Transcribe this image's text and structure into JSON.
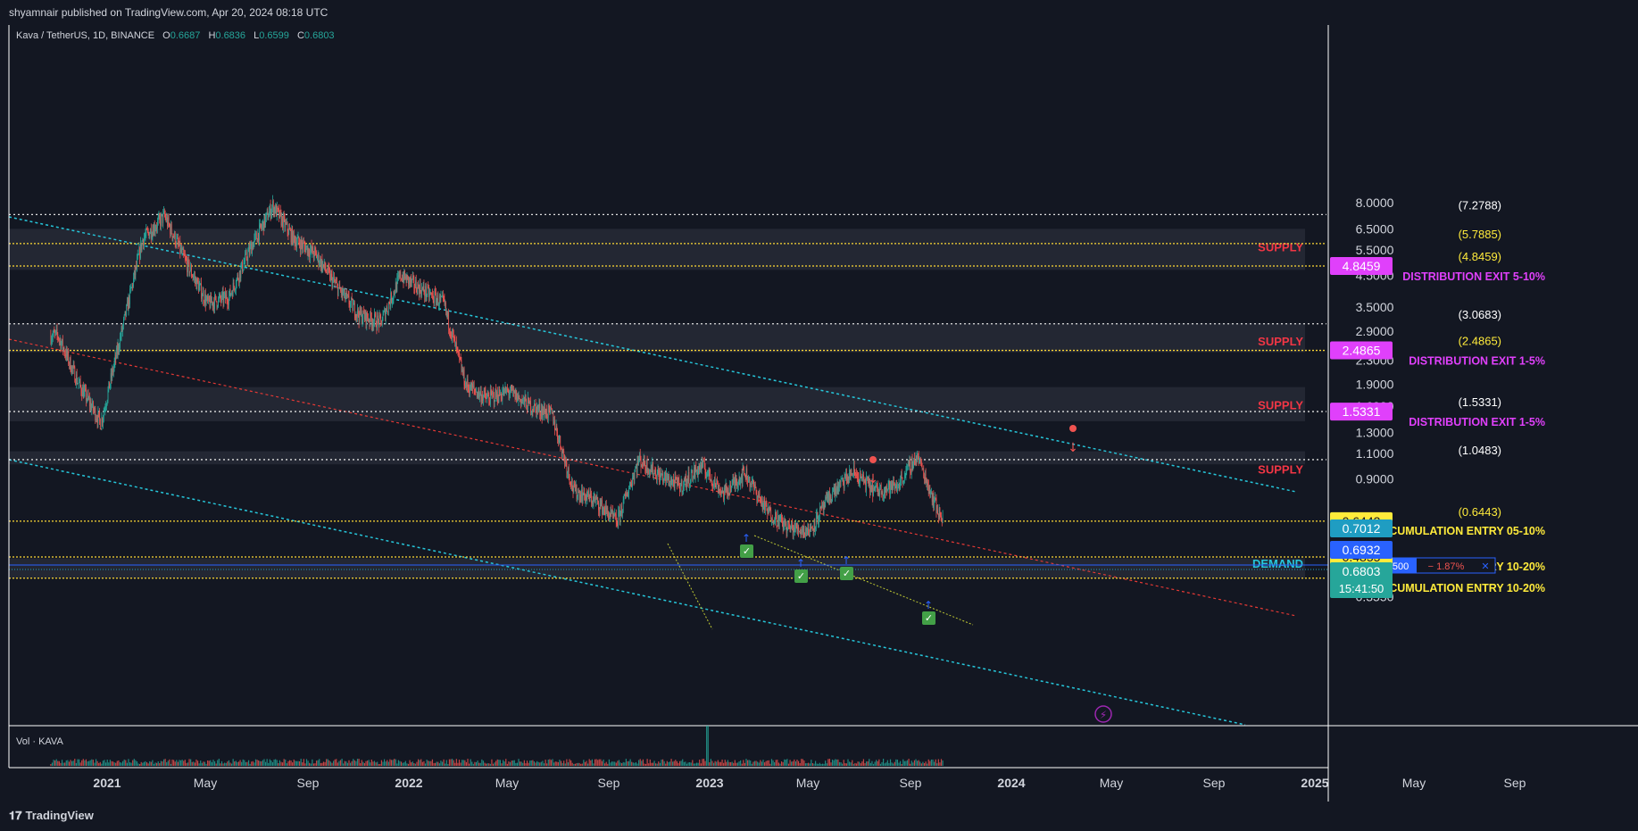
{
  "header": {
    "published": "shyamnair published on TradingView.com, Apr 20, 2024 08:18 UTC"
  },
  "symbol": {
    "title": "Kava / TetherUS, 1D, BINANCE",
    "o_label": "O",
    "o": "0.6687",
    "h_label": "H",
    "h": "0.6836",
    "l_label": "L",
    "l": "0.6599",
    "c_label": "C",
    "c": "0.6803"
  },
  "volume_label": "Vol · KAVA",
  "footer": {
    "brand": "TradingView"
  },
  "colors": {
    "background": "#131722",
    "up": "#26a69a",
    "down": "#ef5350",
    "channel": "#26c6da",
    "midline": "#e53935",
    "supply_text": "#f23645",
    "distribution": "#e040fb",
    "accumulation": "#ffeb3b",
    "demand": "#26c6da"
  },
  "chart_data": {
    "type": "line",
    "title": "",
    "y_scale": "log",
    "ylim": [
      0.33,
      8.6
    ],
    "x_ticks": [
      "2021",
      "May",
      "Sep",
      "2022",
      "May",
      "Sep",
      "2023",
      "May",
      "Sep",
      "2024",
      "May",
      "Sep",
      "2025",
      "May",
      "Sep"
    ],
    "y_ticks": [
      "8.0000",
      "6.5000",
      "5.5000",
      "4.5000",
      "3.5000",
      "2.9000",
      "2.3000",
      "1.9000",
      "1.6000",
      "1.3000",
      "1.1000",
      "0.9000",
      "0.3550"
    ],
    "series": [
      {
        "x": [
          "2020-11",
          "2020-12",
          "2021-01",
          "2021-02",
          "2021-03",
          "2021-04",
          "2021-05",
          "2021-06",
          "2021-07",
          "2021-08",
          "2021-09",
          "2021-10",
          "2021-11",
          "2021-12",
          "2022-01",
          "2022-02",
          "2022-03",
          "2022-04",
          "2022-05",
          "2022-06",
          "2022-07",
          "2022-08",
          "2022-09",
          "2022-10",
          "2022-11",
          "2022-12",
          "2023-01",
          "2023-02",
          "2023-03",
          "2023-04",
          "2023-05",
          "2023-06",
          "2023-07",
          "2023-08",
          "2023-09",
          "2023-10",
          "2023-11",
          "2023-12",
          "2024-01",
          "2024-02",
          "2024-03",
          "2024-04"
        ],
        "values": [
          2.8,
          1.9,
          1.4,
          3.0,
          6.0,
          7.2,
          5.0,
          3.6,
          3.8,
          5.6,
          7.8,
          6.0,
          5.3,
          4.1,
          3.3,
          3.1,
          4.5,
          4.0,
          3.6,
          1.9,
          1.7,
          1.8,
          1.6,
          1.5,
          0.82,
          0.76,
          0.64,
          1.05,
          0.93,
          0.85,
          1.0,
          0.8,
          0.95,
          0.7,
          0.61,
          0.6,
          0.8,
          0.95,
          0.82,
          0.85,
          1.08,
          0.68
        ]
      }
    ],
    "volume": {
      "label": "Vol · KAVA"
    },
    "levels": [
      {
        "value": 7.2788,
        "label": "(7.2788)",
        "label_color": "#ffffff"
      },
      {
        "value": 5.7885,
        "label": "(5.7885)",
        "label_color": "#ffeb3b"
      },
      {
        "value": 4.8459,
        "label": "(4.8459)",
        "label_color": "#ffeb3b",
        "badge": "4.8459",
        "note": "DISTRIBUTION EXIT 5-10%"
      },
      {
        "value": 3.0683,
        "label": "(3.0683)",
        "label_color": "#ffffff"
      },
      {
        "value": 2.4865,
        "label": "(2.4865)",
        "label_color": "#ffeb3b",
        "badge": "2.4865",
        "note": "DISTRIBUTION EXIT 1-5%"
      },
      {
        "value": 1.5331,
        "label": "(1.5331)",
        "label_color": "#ffffff",
        "badge": "1.5331",
        "note": "DISTRIBUTION EXIT 1-5%"
      },
      {
        "value": 1.0483,
        "label": "(1.0483)",
        "label_color": "#ffffff"
      },
      {
        "value": 0.6443,
        "label": "(0.6443)",
        "label_color": "#ffeb3b",
        "badge": "0.6443",
        "note": "ACCUMULATION ENTRY 05-10%"
      },
      {
        "value": 0.4855,
        "badge": "0.4855",
        "note": "ACCUMULATION ENTRY 10-20%"
      },
      {
        "value": 0.4104,
        "badge": "0.4104",
        "note": "ACCUMULATION ENTRY 10-20%"
      }
    ],
    "zones": [
      {
        "label": "SUPPLY",
        "low": 4.7,
        "high": 6.5
      },
      {
        "label": "SUPPLY",
        "low": 2.45,
        "high": 3.08
      },
      {
        "label": "SUPPLY",
        "low": 1.42,
        "high": 1.86
      },
      {
        "label": "SUPPLY",
        "low": 1.01,
        "high": 1.12
      },
      {
        "label": "DEMAND",
        "low": 0.41,
        "high": 0.48
      }
    ],
    "price_badges": [
      {
        "value": "0.7012",
        "color": "#1f9dc2"
      },
      {
        "value": "0.6932",
        "color": "#2962ff"
      },
      {
        "value": "0.6803",
        "sub": "15:41:50",
        "color": "#26a69a"
      }
    ],
    "order": {
      "qty": "1500",
      "pct": "− 1.87%",
      "close": "✕"
    }
  }
}
